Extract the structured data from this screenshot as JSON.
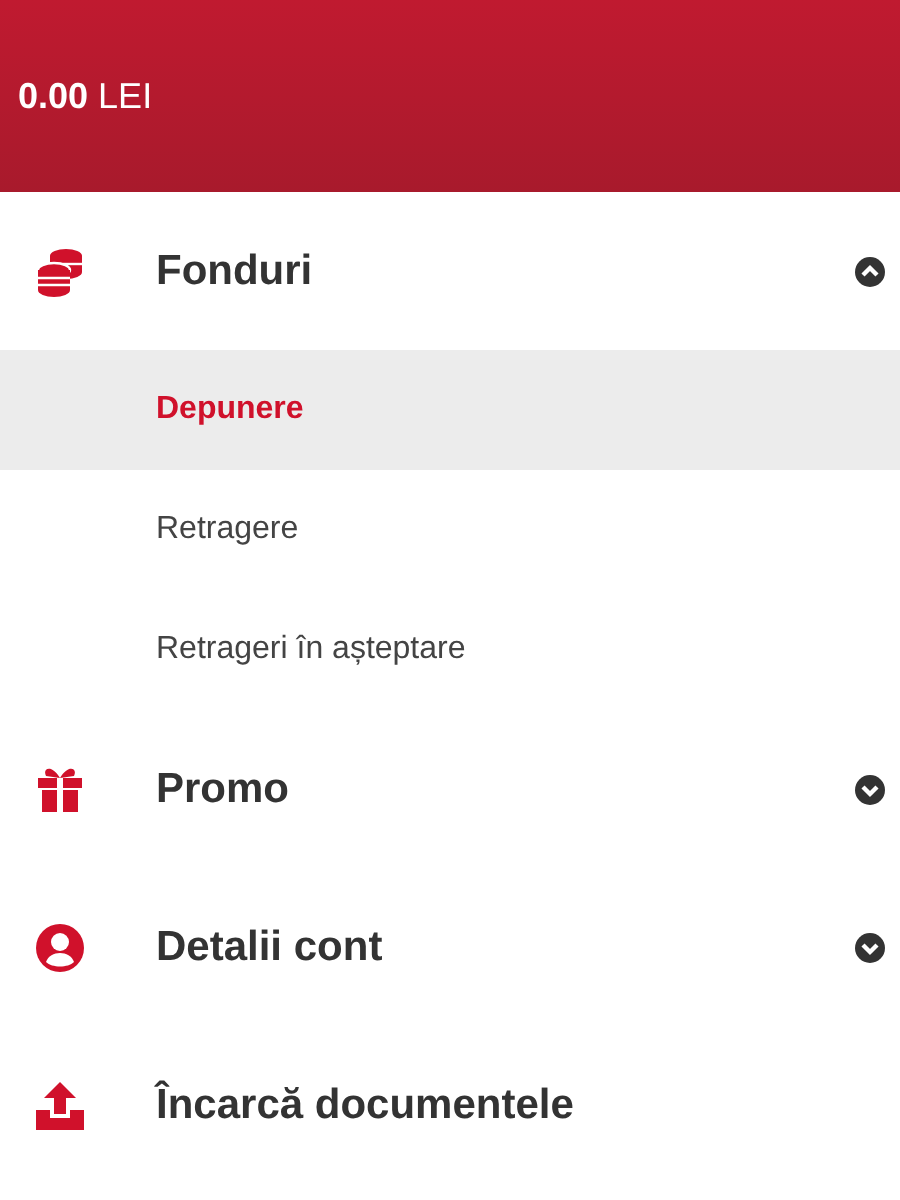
{
  "balance": "**0.00** LEI",
  "menu": [
    {
      "label": "Fonduri",
      "expanded": true,
      "children": [
        {
          "label": "Depunere",
          "selected": true
        },
        {
          "label": "Retragere",
          "selected": false
        },
        {
          "label": "Retrageri în așteptare",
          "selected": false
        }
      ]
    },
    {
      "label": "Promo",
      "expanded": false
    },
    {
      "label": "Detalii cont",
      "expanded": false
    },
    {
      "label": "Încarcă documentele"
    }
  ]
}
